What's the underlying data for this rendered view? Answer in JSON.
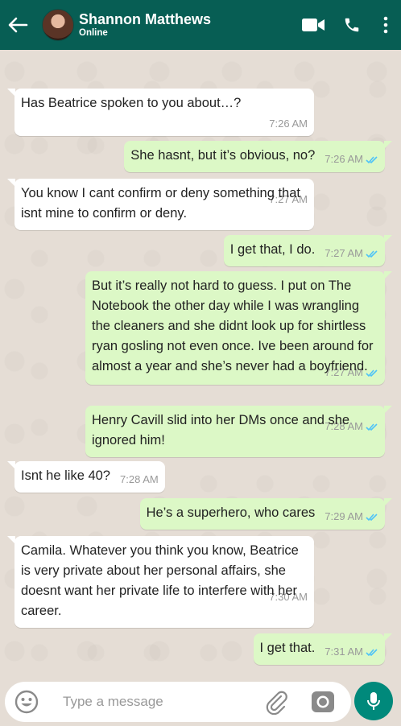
{
  "header": {
    "contact_name": "Shannon Matthews",
    "status": "Online",
    "icons": [
      "back-arrow-icon",
      "video-call-icon",
      "phone-icon",
      "more-options-icon"
    ]
  },
  "messages": [
    {
      "dir": "in",
      "text": "Has Beatrice spoken to you about…?",
      "time": "7:26 AM"
    },
    {
      "dir": "out",
      "text": "She hasnt, but it’s obvious, no?",
      "time": "7:26 AM",
      "read": true
    },
    {
      "dir": "in",
      "text": "You know I cant confirm or deny something that isnt mine to confirm or deny.",
      "time": "7:27 AM"
    },
    {
      "dir": "out",
      "text": "I get that, I do.",
      "time": "7:27 AM",
      "read": true
    },
    {
      "dir": "out",
      "text": "But it’s really not hard to guess. I put on The Notebook the other day while I was wrangling the cleaners and she didnt look up for shirtless ryan gosling not even once. Ive been around for almost a year and she’s never had a boyfriend.",
      "time": "7:27 AM",
      "read": true
    },
    {
      "dir": "out",
      "text": "Henry Cavill slid into her DMs once and she ignored him!",
      "time": "7:28 AM",
      "read": true
    },
    {
      "dir": "in",
      "text": "Isnt he like 40?",
      "time": "7:28 AM"
    },
    {
      "dir": "out",
      "text": "He’s a superhero, who cares",
      "time": "7:29 AM",
      "read": true
    },
    {
      "dir": "in",
      "text": "Camila. Whatever you think you know, Beatrice is very private about her personal affairs, she doesnt want her private life to interfere with her career.",
      "time": "7:30 AM"
    },
    {
      "dir": "out",
      "text": "I get that.",
      "time": "7:31 AM",
      "read": true
    }
  ],
  "composer": {
    "placeholder": "Type a message",
    "icons": [
      "emoji-icon",
      "attach-icon",
      "camera-icon",
      "mic-icon"
    ]
  },
  "colors": {
    "header": "#075e54",
    "outgoing_bubble": "#dcf8c6",
    "incoming_bubble": "#ffffff",
    "read_ticks": "#4fc3f7",
    "mic_button": "#00897b"
  }
}
